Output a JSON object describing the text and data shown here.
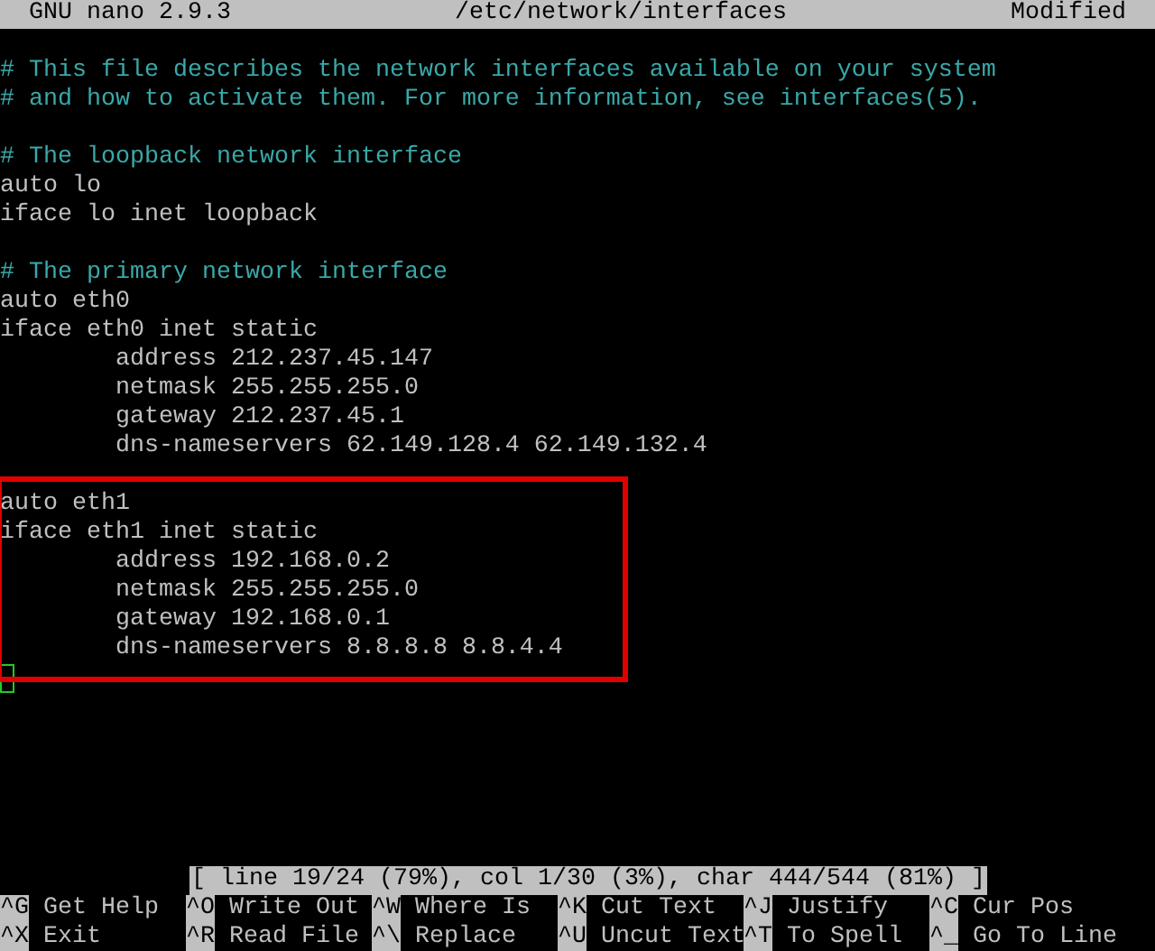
{
  "title_bar": {
    "app": "GNU nano 2.9.3",
    "file": "/etc/network/interfaces",
    "state": "Modified"
  },
  "lines": [
    {
      "kind": "comment",
      "text": "# This file describes the network interfaces available on your system"
    },
    {
      "kind": "comment",
      "text": "# and how to activate them. For more information, see interfaces(5)."
    },
    {
      "kind": "blank"
    },
    {
      "kind": "comment",
      "text": "# The loopback network interface"
    },
    {
      "kind": "code",
      "text": "auto lo"
    },
    {
      "kind": "code",
      "text": "iface lo inet loopback"
    },
    {
      "kind": "blank"
    },
    {
      "kind": "comment",
      "text": "# The primary network interface"
    },
    {
      "kind": "code",
      "text": "auto eth0"
    },
    {
      "kind": "code",
      "text": "iface eth0 inet static"
    },
    {
      "kind": "code",
      "text": "        address 212.237.45.147"
    },
    {
      "kind": "code",
      "text": "        netmask 255.255.255.0"
    },
    {
      "kind": "code",
      "text": "        gateway 212.237.45.1"
    },
    {
      "kind": "code",
      "text": "        dns-nameservers 62.149.128.4 62.149.132.4"
    },
    {
      "kind": "blank"
    },
    {
      "kind": "boxed_group",
      "lines": [
        {
          "kind": "code",
          "text": "auto eth1"
        },
        {
          "kind": "code",
          "text": "iface eth1 inet static"
        },
        {
          "kind": "code",
          "text": "        address 192.168.0.2"
        },
        {
          "kind": "code",
          "text": "        netmask 255.255.255.0"
        },
        {
          "kind": "code",
          "text": "        gateway 192.168.0.1"
        },
        {
          "kind": "code",
          "text": "        dns-nameservers 8.8.8.8 8.8.4.4"
        }
      ]
    },
    {
      "kind": "cursor"
    }
  ],
  "status_bar": "[ line 19/24 (79%), col 1/30 (3%), char 444/544 (81%) ]",
  "shortcuts": [
    [
      {
        "key": "^G",
        "label": "Get Help"
      },
      {
        "key": "^O",
        "label": "Write Out"
      },
      {
        "key": "^W",
        "label": "Where Is"
      },
      {
        "key": "^K",
        "label": "Cut Text"
      },
      {
        "key": "^J",
        "label": "Justify"
      },
      {
        "key": "^C",
        "label": "Cur Pos"
      }
    ],
    [
      {
        "key": "^X",
        "label": "Exit"
      },
      {
        "key": "^R",
        "label": "Read File"
      },
      {
        "key": "^\\",
        "label": "Replace"
      },
      {
        "key": "^U",
        "label": "Uncut Text"
      },
      {
        "key": "^T",
        "label": "To Spell"
      },
      {
        "key": "^_",
        "label": "Go To Line"
      }
    ]
  ]
}
